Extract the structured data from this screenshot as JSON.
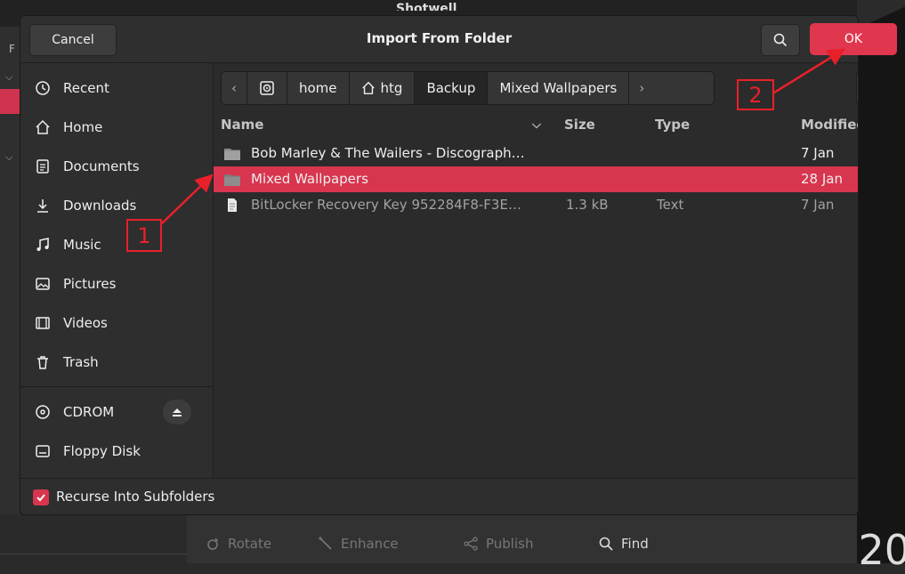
{
  "background_app": {
    "title": "Shotwell",
    "toolbar": [
      {
        "label": "Rotate",
        "icon": "rotate-icon",
        "enabled": false
      },
      {
        "label": "Enhance",
        "icon": "enhance-wand-icon",
        "enabled": false
      },
      {
        "label": "Publish",
        "icon": "share-icon",
        "enabled": false
      },
      {
        "label": "Find",
        "icon": "search-icon",
        "enabled": true
      }
    ],
    "side_letter": "F",
    "right_text": "20"
  },
  "dialog": {
    "title": "Import From Folder",
    "cancel_label": "Cancel",
    "ok_label": "OK",
    "accent": "#d8354f"
  },
  "sidebar": {
    "items": [
      {
        "label": "Recent",
        "icon": "clock-icon"
      },
      {
        "label": "Home",
        "icon": "home-icon"
      },
      {
        "label": "Documents",
        "icon": "document-icon"
      },
      {
        "label": "Downloads",
        "icon": "download-icon"
      },
      {
        "label": "Music",
        "icon": "music-icon"
      },
      {
        "label": "Pictures",
        "icon": "picture-icon"
      },
      {
        "label": "Videos",
        "icon": "film-icon"
      },
      {
        "label": "Trash",
        "icon": "trash-icon"
      }
    ],
    "devices": [
      {
        "label": "CDROM",
        "icon": "disc-icon"
      },
      {
        "label": "Floppy Disk",
        "icon": "drive-icon"
      }
    ]
  },
  "pathbar": {
    "crumbs": [
      "home",
      "htg",
      "Backup",
      "Mixed Wallpapers"
    ],
    "active": "Backup"
  },
  "filelist": {
    "columns": {
      "name": "Name",
      "size": "Size",
      "type": "Type",
      "modified": "Modified"
    },
    "rows": [
      {
        "name": "Bob Marley & The Wailers - Discograph…",
        "size": "",
        "type": "",
        "modified": "7 Jan",
        "kind": "folder"
      },
      {
        "name": "Mixed Wallpapers",
        "size": "",
        "type": "",
        "modified": "28 Jan",
        "kind": "folder",
        "selected": true
      },
      {
        "name": "BitLocker Recovery Key 952284F8-F3E…",
        "size": "1.3 kB",
        "type": "Text",
        "modified": "7 Jan",
        "kind": "file"
      }
    ]
  },
  "footer": {
    "recurse_label": "Recurse Into Subfolders",
    "recurse_checked": true
  },
  "annotations": {
    "step1": "1",
    "step2": "2",
    "color": "#e8202a"
  }
}
